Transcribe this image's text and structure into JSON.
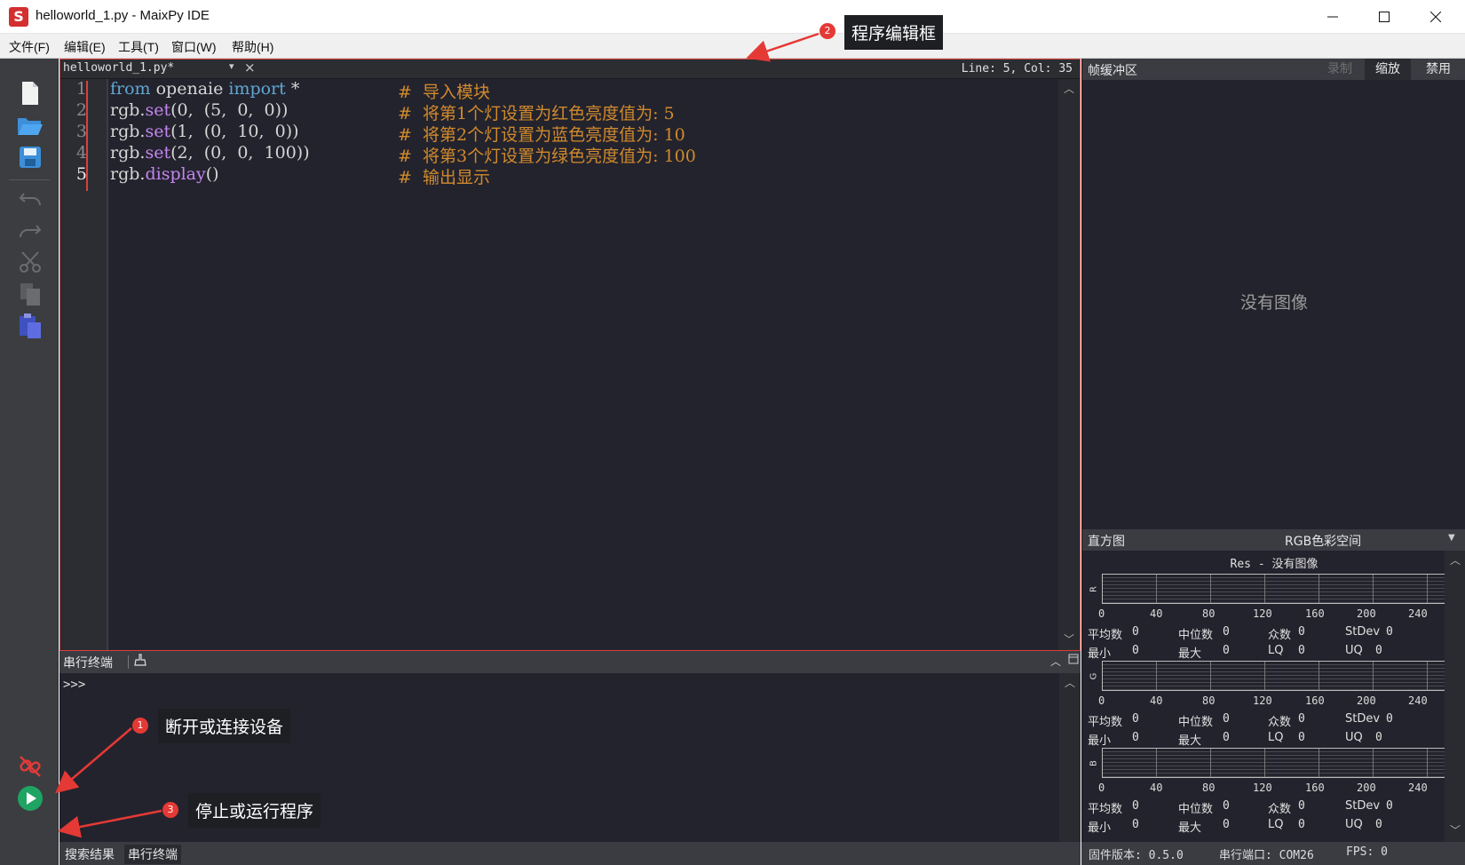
{
  "window": {
    "title": "helloworld_1.py - MaixPy IDE",
    "logo_letter": "S"
  },
  "menu": [
    "文件(F)",
    "编辑(E)",
    "工具(T)",
    "窗口(W)",
    "帮助(H)"
  ],
  "editor": {
    "tab_label": "helloworld_1.py*",
    "cursor_position": "Line: 5, Col: 35",
    "line_numbers": [
      "1",
      "2",
      "3",
      "4",
      "5"
    ],
    "lines": [
      {
        "a": "from",
        "b": " openaie ",
        "c": "import",
        "d": " *",
        "comment": "#  导入模块"
      },
      {
        "a": "rgb.",
        "b": "set",
        "c": "(0,  (5,  0,  0))",
        "comment": "#  将第1个灯设置为红色亮度值为: 5"
      },
      {
        "a": "rgb.",
        "b": "set",
        "c": "(1,  (0,  10,  0))",
        "comment": "#  将第2个灯设置为蓝色亮度值为: 10"
      },
      {
        "a": "rgb.",
        "b": "set",
        "c": "(2,  (0,  0,  100))",
        "comment": "#  将第3个灯设置为绿色亮度值为: 100"
      },
      {
        "a": "rgb.",
        "b": "display",
        "c": "()",
        "comment": "#  输出显示"
      }
    ]
  },
  "terminal": {
    "title": "串行终端",
    "prompt": ">>>"
  },
  "bottom_tabs": [
    "搜索结果",
    "串行终端"
  ],
  "status": {
    "firmware": "固件版本: 0.5.0",
    "port": "串行端口: COM26",
    "fps": "FPS: 0"
  },
  "framebuffer": {
    "title": "帧缓冲区",
    "record": "录制",
    "zoom": "缩放",
    "disable": "禁用",
    "no_image": "没有图像"
  },
  "histogram": {
    "title": "直方图",
    "color_space": "RGB色彩空间",
    "res_label": "Res - 没有图像",
    "ticks": [
      "0",
      "40",
      "80",
      "120",
      "160",
      "200",
      "240"
    ],
    "channels": [
      {
        "axis": "R"
      },
      {
        "axis": "G"
      },
      {
        "axis": "B"
      }
    ],
    "stats_labels": {
      "mean": "平均数",
      "median": "中位数",
      "mode": "众数",
      "stdev": "StDev",
      "min": "最小",
      "max": "最大",
      "lq": "LQ",
      "uq": "UQ"
    },
    "stats_value": "0"
  },
  "annotations": {
    "a1": {
      "num": "1",
      "text": "断开或连接设备"
    },
    "a2": {
      "num": "2",
      "text": "程序编辑框"
    },
    "a3": {
      "num": "3",
      "text": "停止或运行程序"
    }
  },
  "colors": {
    "accent_red": "#d9403b",
    "editor_bg": "#23232d",
    "keyword": "#5fa8d3",
    "function": "#c586f0",
    "comment": "#d08a2d"
  }
}
